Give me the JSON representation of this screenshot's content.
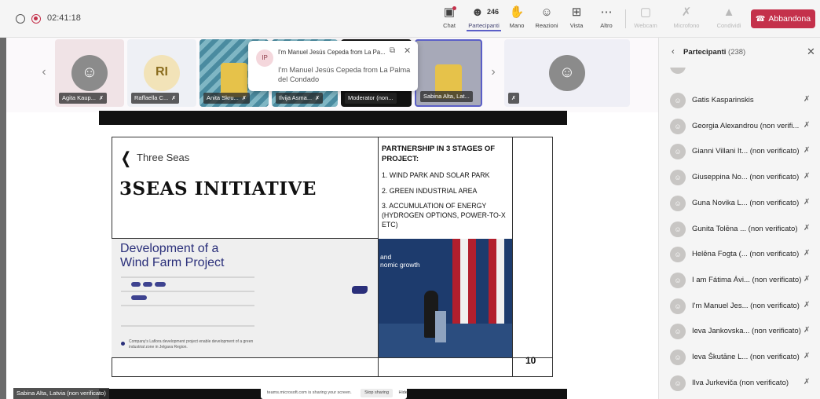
{
  "topbar": {
    "time": "02:41:18",
    "chat_label": "Chat",
    "participants_label": "Partecipanti",
    "participants_count": "246",
    "hand_label": "Mano",
    "reactions_label": "Reazioni",
    "view_label": "Vista",
    "more_label": "Altro",
    "webcam_label": "Webcam",
    "mic_label": "Microfono",
    "share_label": "Condividi",
    "leave_label": "Abbandona",
    "leave_color": "#c4314b"
  },
  "tiles": [
    {
      "name": "Agita Kaup..."
    },
    {
      "name": "Raffaella C...",
      "initials": "RI"
    },
    {
      "name": "Anita Skru..."
    },
    {
      "name": "Ilvija Asma..."
    },
    {
      "name": "Moderator (non..."
    },
    {
      "name": "Sabina Alta, Lat..."
    },
    {
      "name": ""
    }
  ],
  "toast": {
    "initials": "IP",
    "title": "I'm Manuel Jesús Cepeda from La Pa...",
    "body": "I'm Manuel Jesús Cepeda from La Palma del Condado"
  },
  "slide": {
    "logo_text": "Three Seas",
    "initiative_title": "3SEAS INITIATIVE",
    "partnership_title": "PARTNERSHIP IN 3 STAGES OF PROJECT:",
    "items": [
      "1. WIND PARK AND SOLAR PARK",
      "2. GREEN INDUSTRIAL AREA",
      "3. ACCUMULATION OF ENERGY (HYDROGEN OPTIONS, POWER-TO-X ETC)"
    ],
    "wind_title": "Development of a Wind Farm Project",
    "wind_desc": "Company's Laflora development project enable development of a green industrial zone in Jelgava Region.",
    "photo_text": "and\nnomic growth",
    "page_number": "10"
  },
  "share_bar": {
    "text": "teams.microsoft.com is sharing your screen.",
    "stop_label": "Stop sharing",
    "hide_label": "Hide"
  },
  "bottom_name": "Sabina Alta, Latvia (non verificato)",
  "panel": {
    "title": "Partecipanti",
    "count": "(238)",
    "people": [
      "Gatis Kasparinskis",
      "Georgia Alexandrou (non verifi...",
      "Gianni Villani It... (non verificato)",
      "Giuseppina No... (non verificato)",
      "Guna Novika L... (non verificato)",
      "Gunita Tolēna ... (non verificato)",
      "Helēna Fogta (... (non verificato)",
      "I am Fátima Ávi... (non verificato)",
      "I'm Manuel Jes... (non verificato)",
      "Ieva Jankovska... (non verificato)",
      "Ieva Škutāne L... (non verificato)",
      "Ilva Jurkeviča (non verificato)"
    ]
  }
}
